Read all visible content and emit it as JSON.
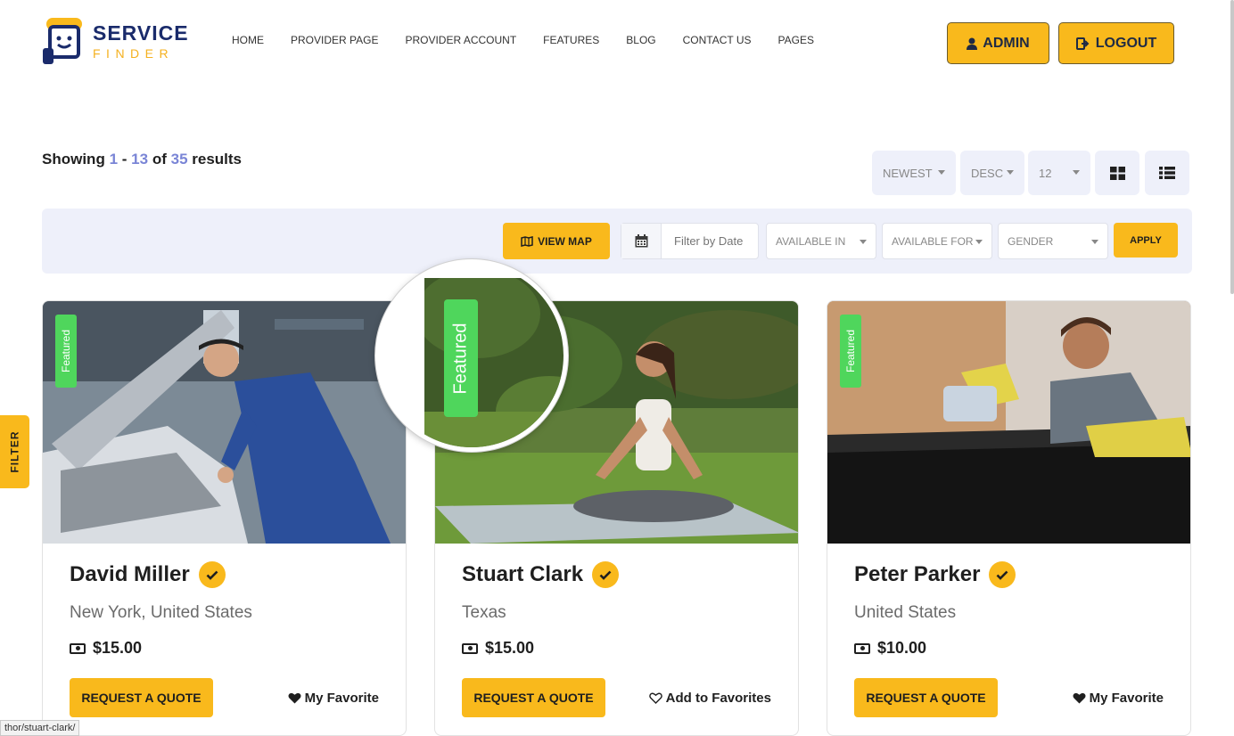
{
  "brand": {
    "title": "SERVICE",
    "subtitle": "FINDER"
  },
  "nav": [
    "HOME",
    "PROVIDER PAGE",
    "PROVIDER ACCOUNT",
    "FEATURES",
    "BLOG",
    "CONTACT US",
    "PAGES"
  ],
  "header_buttons": {
    "admin": "ADMIN",
    "logout": "LOGOUT"
  },
  "results": {
    "prefix": "Showing",
    "from": "1",
    "dash": "-",
    "to": "13",
    "of": "of",
    "total": "35",
    "suffix": "results"
  },
  "sorting": {
    "order_by": "NEWEST",
    "direction": "DESC",
    "per_page": "12"
  },
  "filters": {
    "view_map": "VIEW MAP",
    "date_placeholder": "Filter by Date",
    "available_in": "AVAILABLE IN",
    "available_for": "AVAILABLE FOR",
    "gender": "GENDER",
    "apply": "APPLY"
  },
  "side_tab": "FILTER",
  "featured_label": "Featured",
  "providers": [
    {
      "name": "David Miller",
      "location": "New York, United States",
      "price": "$15.00",
      "cta": "REQUEST A QUOTE",
      "favorite": "My Favorite",
      "favorited": true
    },
    {
      "name": "Stuart Clark",
      "location": "Texas",
      "price": "$15.00",
      "cta": "REQUEST A QUOTE",
      "favorite": "Add to Favorites",
      "favorited": false
    },
    {
      "name": "Peter Parker",
      "location": "United States",
      "price": "$10.00",
      "cta": "REQUEST A QUOTE",
      "favorite": "My Favorite",
      "favorited": true
    }
  ],
  "status_url": "thor/stuart-clark/",
  "colors": {
    "accent": "#f9b91c",
    "brand_navy": "#1a2b6b",
    "featured_green": "#4fd65c",
    "panel_bg": "#eef0fa",
    "highlight_num": "#7a85d6"
  }
}
